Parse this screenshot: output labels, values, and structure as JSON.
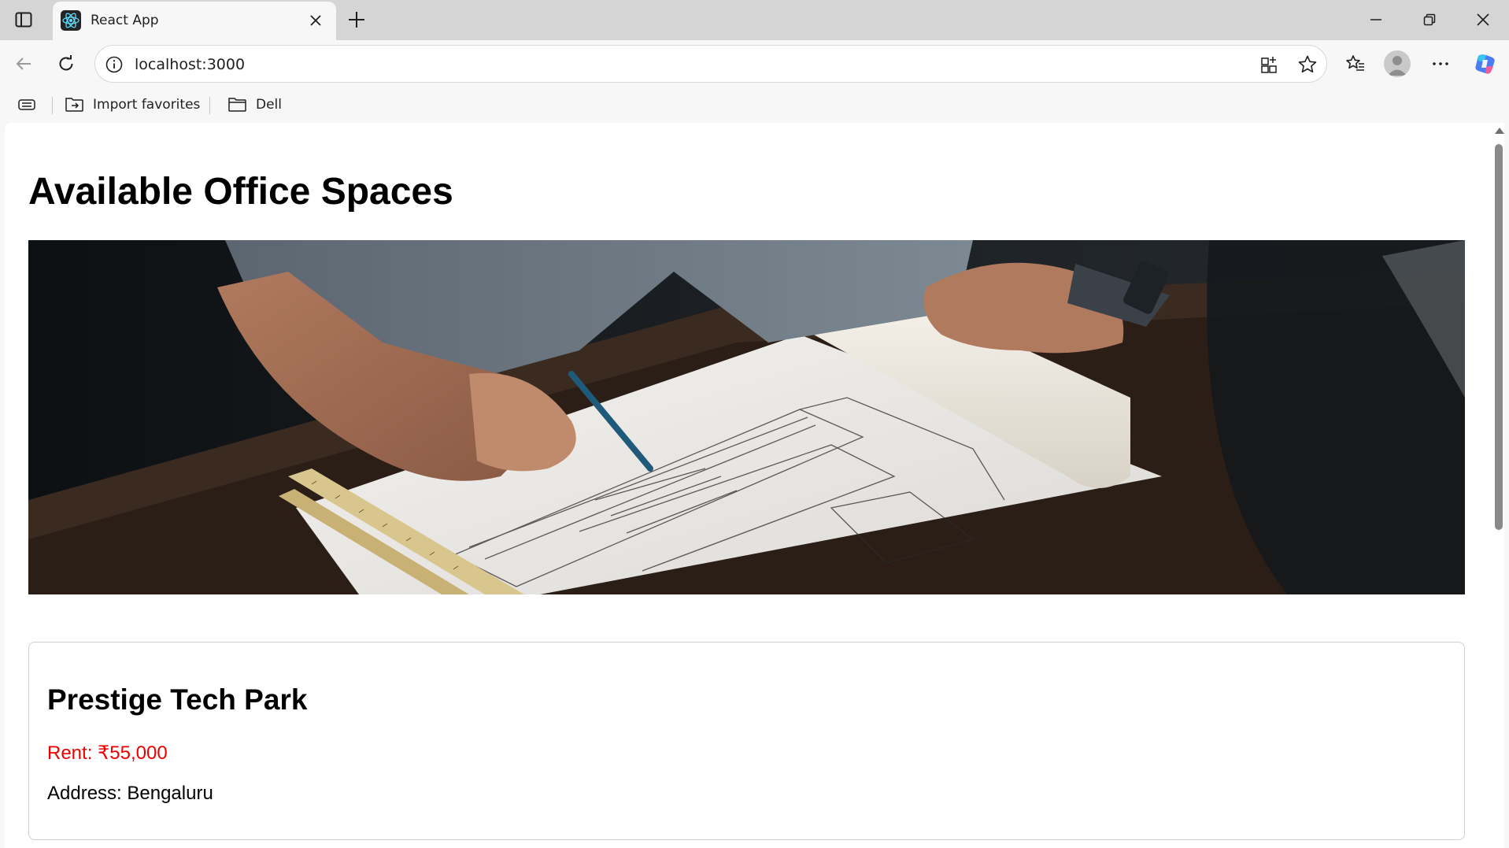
{
  "browser": {
    "tab": {
      "title": "React App",
      "favicon": "react-logo-icon"
    },
    "address_bar": {
      "url": "localhost:3000"
    },
    "bookmarks": [
      {
        "label": "Import favorites",
        "icon": "import-folder-icon"
      },
      {
        "label": "Dell",
        "icon": "folder-icon"
      }
    ],
    "colors": {
      "chrome_bg": "#f7f7f7",
      "tabstrip_bg": "#d5d5d5"
    }
  },
  "page": {
    "title": "Available Office Spaces",
    "hero_image": {
      "subject": "architect-drawing-blueprint-photo"
    },
    "listings": [
      {
        "name": "Prestige Tech Park",
        "rent_text": "Rent: ₹55,000",
        "address_text": "Address: Bengaluru"
      }
    ],
    "colors": {
      "rent_text": "#ee0000",
      "text": "#000000"
    }
  }
}
